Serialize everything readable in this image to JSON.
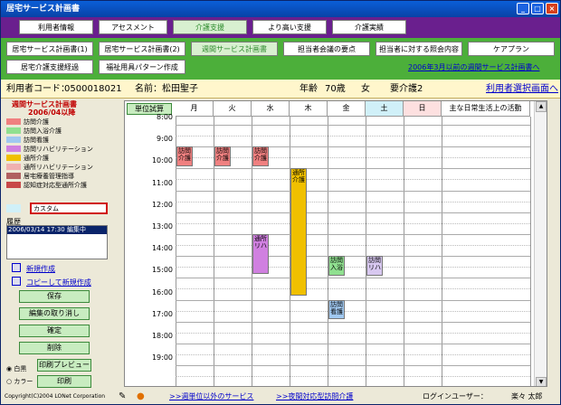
{
  "window": {
    "title": "居宅サービス計画書"
  },
  "nav_row1": [
    "利用者情報",
    "アセスメント",
    "介護支援",
    "より高い支援",
    "介護実績"
  ],
  "nav_row2": [
    "居宅サービス計画書(1)",
    "居宅サービス計画書(2)",
    "週間サービス計画書",
    "担当者会議の要点",
    "担当者に対する照会内容",
    "ケアプラン"
  ],
  "nav_row3": [
    "居宅介護支援経過",
    "福祉用具パターン作成"
  ],
  "prev_link": "2006年3月以前の週間サービス計画書へ",
  "patient": {
    "code_label": "利用者コード：",
    "code": "0500018021",
    "name_label": "名前：",
    "name": "松田聖子",
    "age_label": "年齢",
    "age": "70歳",
    "gender": "女",
    "care_level": "要介護2",
    "select_link": "利用者選択画面へ"
  },
  "plan": {
    "title": "週間サービス計画書",
    "period": "2006/04以降"
  },
  "legend": [
    {
      "label": "訪問介護",
      "color": "#f08080"
    },
    {
      "label": "訪問入浴介護",
      "color": "#90e090"
    },
    {
      "label": "訪問看護",
      "color": "#a0c8f0"
    },
    {
      "label": "訪問リハビリテーション",
      "color": "#d080e0"
    },
    {
      "label": "通所介護",
      "color": "#f0c000"
    },
    {
      "label": "通所リハビリテーション",
      "color": "#f0b0b0"
    },
    {
      "label": "居宅療養管理指導",
      "color": "#b06060"
    },
    {
      "label": "認知症対応型通所介護",
      "color": "#c84848"
    }
  ],
  "custom_label": "カスタム",
  "history": {
    "label": "履歴",
    "items": [
      "2006/03/14 17:30 編集中"
    ]
  },
  "actions": {
    "new_create": "新規作成",
    "copy_create": "コピーして新規作成",
    "save": "保存",
    "cancel_edit": "編集の取り消し",
    "confirm": "確定",
    "delete": "削除",
    "print_preview": "印刷プレビュー",
    "print": "印刷",
    "mono": "白黒",
    "color": "カラー"
  },
  "grid": {
    "unit_calc": "単位試算",
    "days": [
      "月",
      "火",
      "水",
      "木",
      "金",
      "土",
      "日"
    ],
    "activities_header": "主な日常生活上の活動",
    "times": [
      "8:00",
      "9:00",
      "10:00",
      "11:00",
      "12:00",
      "13:00",
      "14:00",
      "15:00",
      "16:00",
      "17:00",
      "18:00",
      "19:00"
    ],
    "events": [
      {
        "day": 0,
        "start": 9.0,
        "end": 9.9,
        "label": "訪問\n介護",
        "color": "#f08080"
      },
      {
        "day": 1,
        "start": 9.0,
        "end": 9.9,
        "label": "訪問\n介護",
        "color": "#f08080"
      },
      {
        "day": 2,
        "start": 9.0,
        "end": 9.9,
        "label": "訪問\n介護",
        "color": "#f08080"
      },
      {
        "day": 3,
        "start": 10.0,
        "end": 15.8,
        "label": "通所\n介護",
        "color": "#f0c000"
      },
      {
        "day": 2,
        "start": 13.0,
        "end": 14.8,
        "label": "通所\nリハ",
        "color": "#d080e0"
      },
      {
        "day": 4,
        "start": 14.0,
        "end": 14.9,
        "label": "訪問\n入浴",
        "color": "#90e090"
      },
      {
        "day": 5,
        "start": 14.0,
        "end": 14.9,
        "label": "訪問\nリハ",
        "color": "#d8c8f0"
      },
      {
        "day": 4,
        "start": 16.0,
        "end": 16.9,
        "label": "訪問\n看護",
        "color": "#a0c8f0"
      }
    ]
  },
  "status": {
    "copyright": "Copyright(C)2004 LONet Corporation",
    "link1": ">>週単位以外のサービス",
    "link2": ">>夜間対応型訪問介護",
    "login_label": "ログインユーザー：",
    "login_user": "楽々 太郎"
  }
}
